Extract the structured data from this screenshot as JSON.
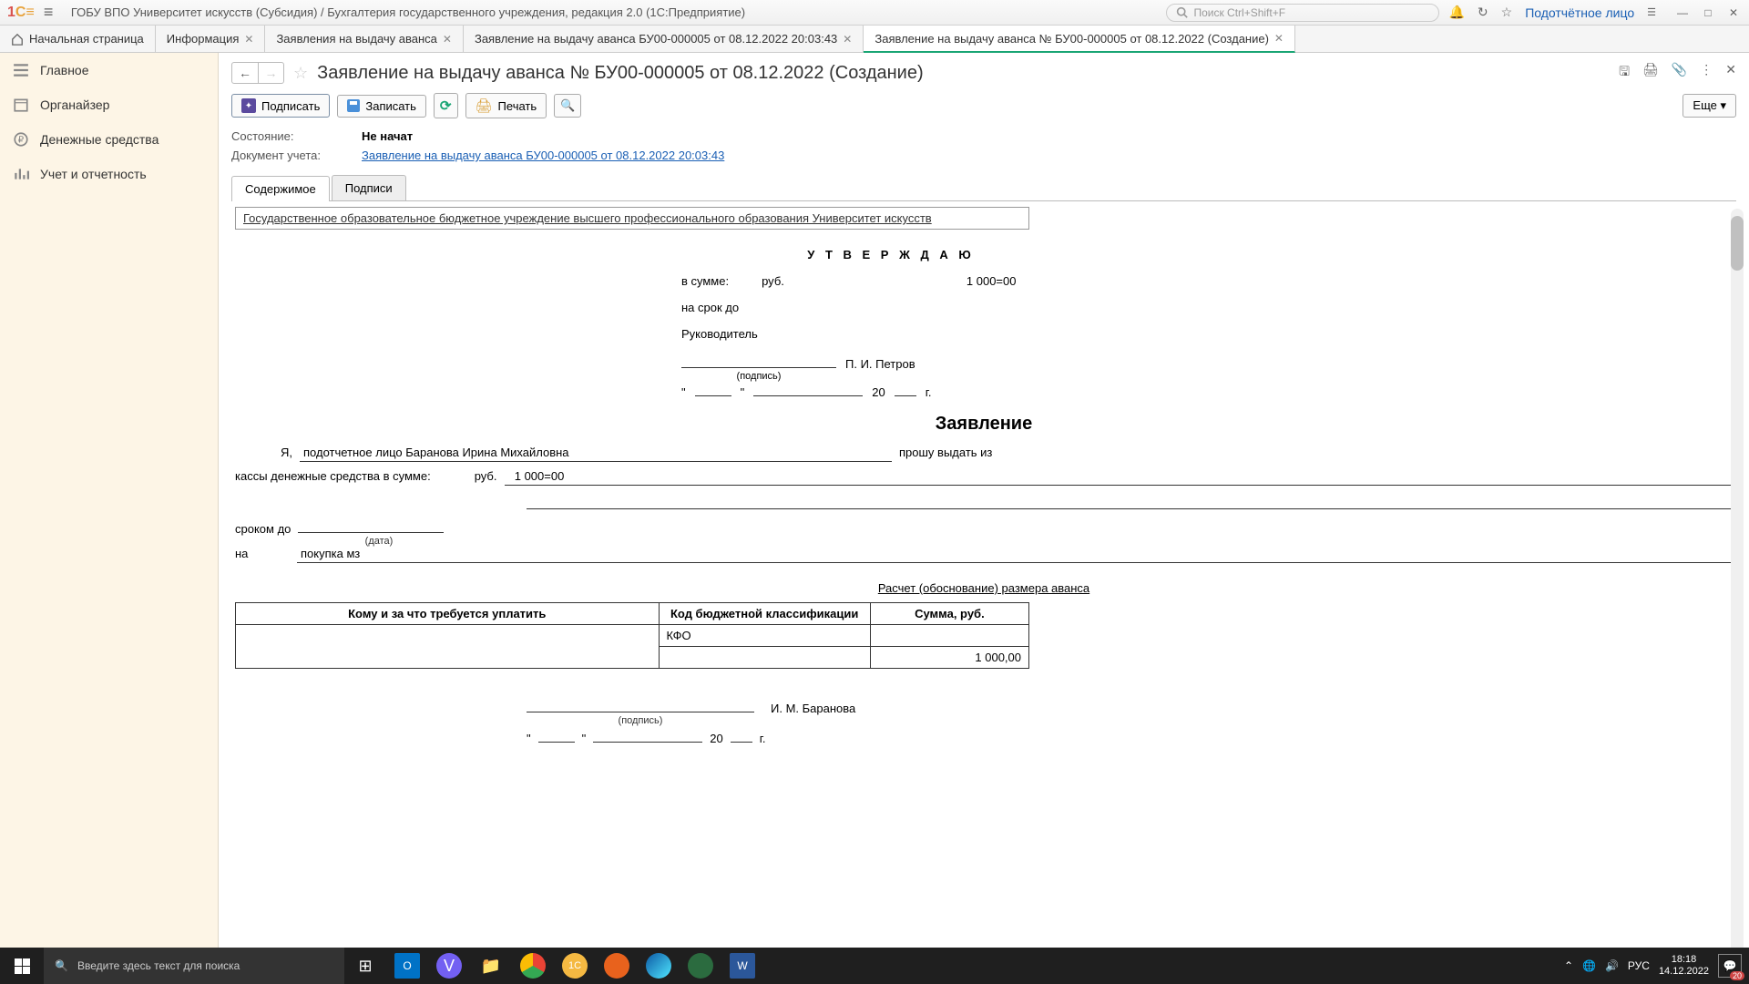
{
  "titlebar": {
    "title": "ГОБУ ВПО Университет искусств (Субсидия) / Бухгалтерия государственного учреждения, редакция 2.0  (1С:Предприятие)",
    "search_placeholder": "Поиск Ctrl+Shift+F",
    "user": "Подотчётное лицо"
  },
  "tabs": [
    {
      "label": "Начальная страница"
    },
    {
      "label": "Информация"
    },
    {
      "label": "Заявления на выдачу аванса"
    },
    {
      "label": "Заявление на выдачу аванса БУ00-000005 от 08.12.2022 20:03:43"
    },
    {
      "label": "Заявление на выдачу аванса № БУ00-000005 от 08.12.2022 (Создание)"
    }
  ],
  "sidebar": {
    "items": [
      {
        "label": "Главное"
      },
      {
        "label": "Органайзер"
      },
      {
        "label": "Денежные средства"
      },
      {
        "label": "Учет и отчетность"
      }
    ]
  },
  "page": {
    "title": "Заявление на выдачу аванса № БУ00-000005 от 08.12.2022 (Создание)"
  },
  "toolbar": {
    "sign": "Подписать",
    "save": "Записать",
    "print": "Печать",
    "more": "Еще"
  },
  "status": {
    "state_label": "Состояние:",
    "state_value": "Не начат",
    "doc_label": "Документ учета:",
    "doc_link": "Заявление на выдачу аванса БУ00-000005 от 08.12.2022 20:03:43"
  },
  "inner_tabs": {
    "content": "Содержимое",
    "signs": "Подписи"
  },
  "doc": {
    "org": "Государственное образовательное бюджетное учреждение высшего профессионального образования Университет искусств",
    "approve": "У Т В Е Р Ж Д А Ю",
    "in_sum": "в сумме:",
    "rub": "руб.",
    "amount": "1 000=00",
    "term": "на срок до",
    "head": "Руководитель",
    "head_name": "П. И. Петров",
    "sign_caption": "(подпись)",
    "year20": "20",
    "g": "г.",
    "h2": "Заявление",
    "ya": "Я,",
    "person": "подотчетное лицо Баранова Ирина Михайловна",
    "ask": "прошу выдать из",
    "cash": "кассы денежные средства в сумме:",
    "amount2": "1 000=00",
    "term_to": "сроком до",
    "date_caption": "(дата)",
    "on": "на",
    "purpose": "покупка мз",
    "calc_title": "Расчет (обоснование) размера аванса",
    "table": {
      "h1": "Кому и за что требуется уплатить",
      "h2": "Код бюджетной классификации",
      "h3": "Сумма, руб.",
      "r1c2": "КФО",
      "r1c3": "1 000,00"
    },
    "signer": "И. М. Баранова"
  },
  "taskbar": {
    "search": "Введите здесь текст для поиска",
    "lang": "РУС",
    "time": "18:18",
    "date": "14.12.2022",
    "notif": "20"
  }
}
